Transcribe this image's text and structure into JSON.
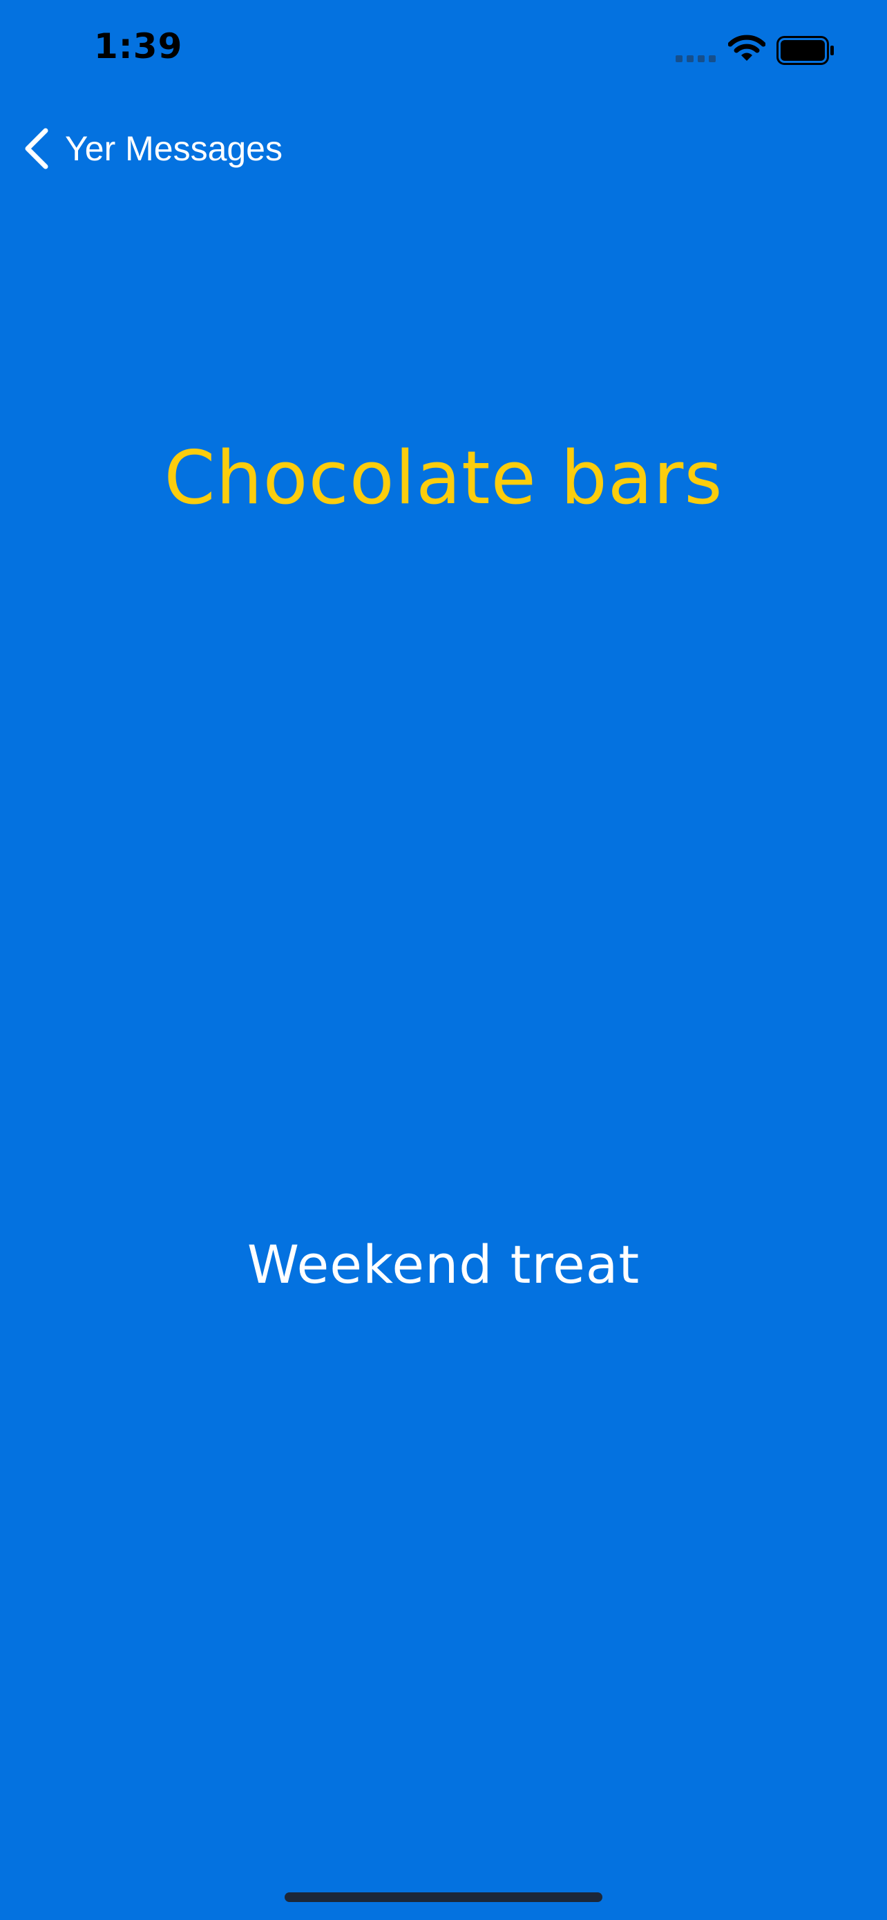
{
  "status_bar": {
    "time": "1:39",
    "icons": [
      "signal-icon",
      "wifi-icon",
      "battery-icon"
    ]
  },
  "nav": {
    "back_label": "Yer Messages",
    "back_icon": "chevron-left-icon"
  },
  "content": {
    "title": "Chocolate bars",
    "subtitle": "Weekend treat"
  },
  "colors": {
    "background": "#0472e0",
    "title": "#fccd0d",
    "text": "#ffffff",
    "status_text": "#000000"
  }
}
